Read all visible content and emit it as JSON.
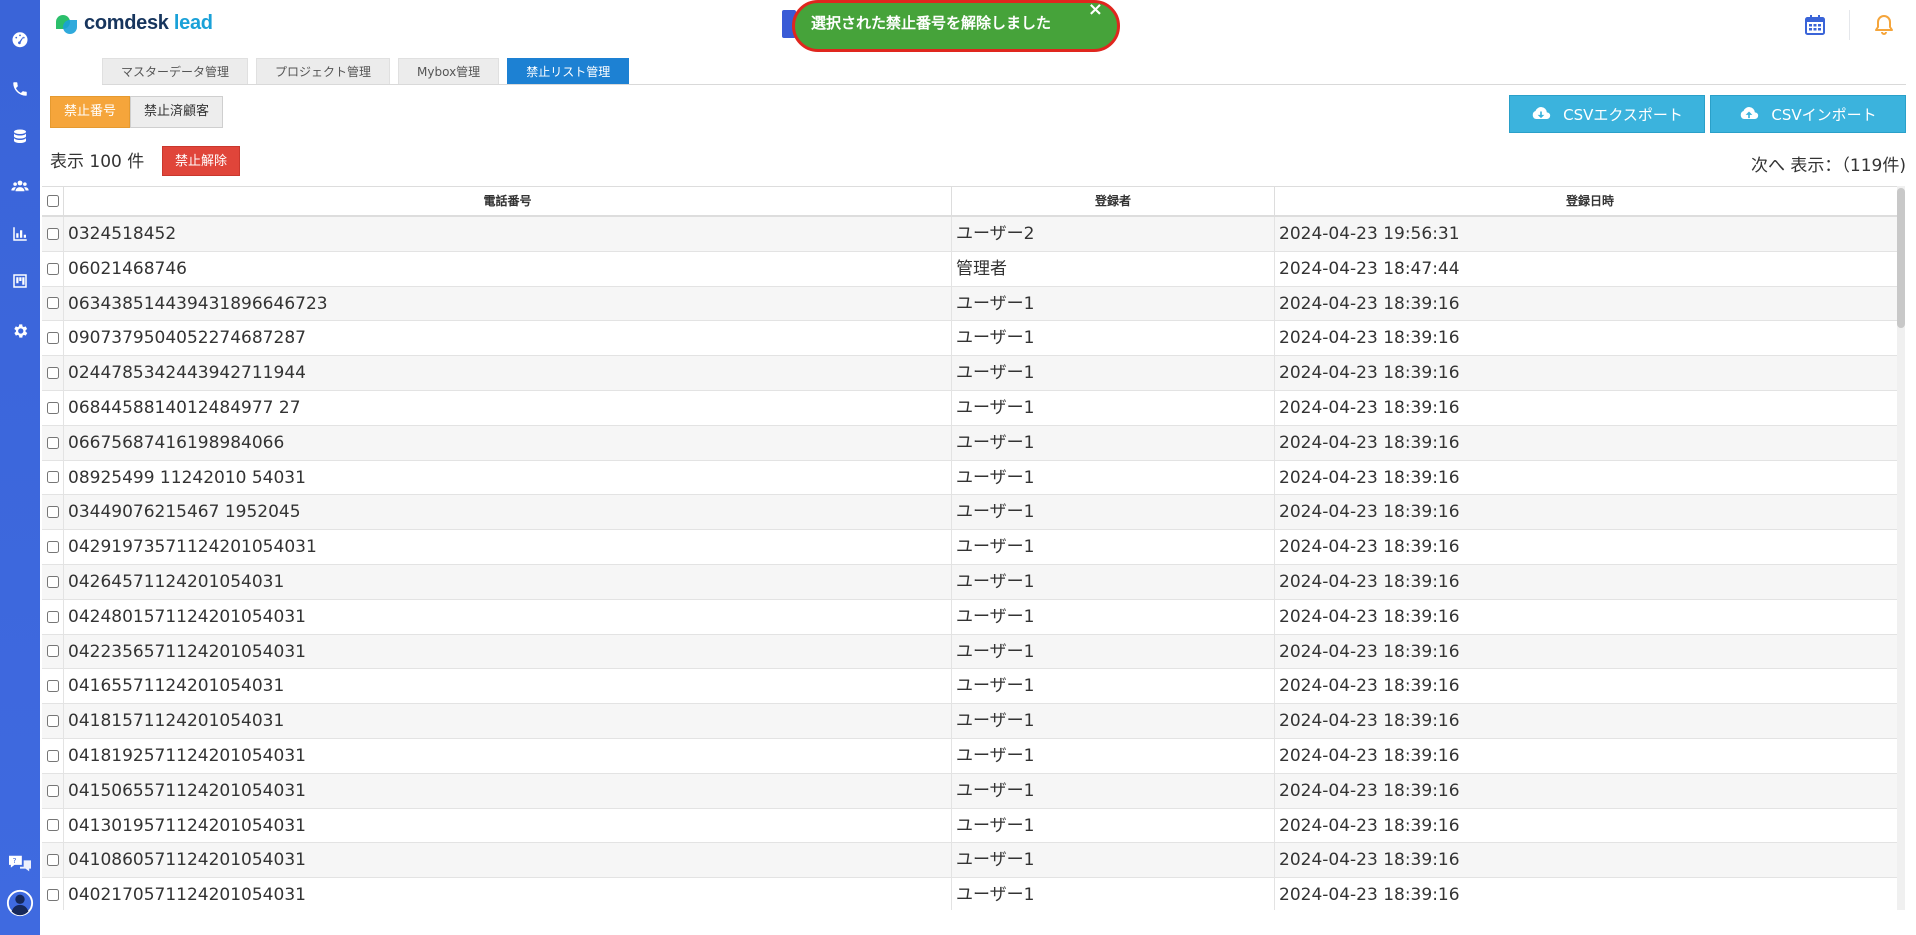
{
  "app": {
    "logo_main": "comdesk",
    "logo_sub": "lead"
  },
  "sidebar": {
    "icons": [
      "dashboard-icon",
      "phone-icon",
      "database-icon",
      "users-icon",
      "chart-icon",
      "kanban-icon",
      "settings-icon",
      "chat-help-icon",
      "profile-icon"
    ]
  },
  "toast": {
    "message": "選択された禁止番号を解除しました",
    "close": "×"
  },
  "header": {
    "icons": [
      "calendar-icon",
      "bell-icon"
    ],
    "colors": {
      "calendar": "#3a64d8",
      "bell": "#f5a53b"
    }
  },
  "tabs": [
    {
      "label": "マスターデータ管理",
      "active": false
    },
    {
      "label": "プロジェクト管理",
      "active": false
    },
    {
      "label": "Mybox管理",
      "active": false
    },
    {
      "label": "禁止リスト管理",
      "active": true
    }
  ],
  "toggle": {
    "numbers_label": "禁止番号",
    "customers_label": "禁止済顧客"
  },
  "csv": {
    "export_label": "CSVエクスポート",
    "import_label": "CSVインポート"
  },
  "list": {
    "show_count": "表示 100 件",
    "unblock_label": "禁止解除",
    "next_info": "次へ 表示：（119件)"
  },
  "table": {
    "headers": {
      "phone": "電話番号",
      "registrant": "登録者",
      "datetime": "登録日時"
    },
    "rows": [
      {
        "phone": "0324518452",
        "registrant": "ユーザー2",
        "datetime": "2024-04-23 19:56:31"
      },
      {
        "phone": "06021468746",
        "registrant": "管理者",
        "datetime": "2024-04-23 18:47:44"
      },
      {
        "phone": "063438514439431896646723",
        "registrant": "ユーザー1",
        "datetime": "2024-04-23 18:39:16"
      },
      {
        "phone": "0907379504052274687287",
        "registrant": "ユーザー1",
        "datetime": "2024-04-23 18:39:16"
      },
      {
        "phone": "0244785342443942711944",
        "registrant": "ユーザー1",
        "datetime": "2024-04-23 18:39:16"
      },
      {
        "phone": "0684458814012484977 27",
        "registrant": "ユーザー1",
        "datetime": "2024-04-23 18:39:16"
      },
      {
        "phone": "06675687416198984066",
        "registrant": "ユーザー1",
        "datetime": "2024-04-23 18:39:16"
      },
      {
        "phone": "08925499 11242010 54031",
        "registrant": "ユーザー1",
        "datetime": "2024-04-23 18:39:16"
      },
      {
        "phone": "03449076215467 1952045",
        "registrant": "ユーザー1",
        "datetime": "2024-04-23 18:39:16"
      },
      {
        "phone": "04291973571124201054031",
        "registrant": "ユーザー1",
        "datetime": "2024-04-23 18:39:16"
      },
      {
        "phone": "04264571124201054031",
        "registrant": "ユーザー1",
        "datetime": "2024-04-23 18:39:16"
      },
      {
        "phone": "0424801571124201054031",
        "registrant": "ユーザー1",
        "datetime": "2024-04-23 18:39:16"
      },
      {
        "phone": "0422356571124201054031",
        "registrant": "ユーザー1",
        "datetime": "2024-04-23 18:39:16"
      },
      {
        "phone": "04165571124201054031",
        "registrant": "ユーザー1",
        "datetime": "2024-04-23 18:39:16"
      },
      {
        "phone": "04181571124201054031",
        "registrant": "ユーザー1",
        "datetime": "2024-04-23 18:39:16"
      },
      {
        "phone": "0418192571124201054031",
        "registrant": "ユーザー1",
        "datetime": "2024-04-23 18:39:16"
      },
      {
        "phone": "0415065571124201054031",
        "registrant": "ユーザー1",
        "datetime": "2024-04-23 18:39:16"
      },
      {
        "phone": "0413019571124201054031",
        "registrant": "ユーザー1",
        "datetime": "2024-04-23 18:39:16"
      },
      {
        "phone": "0410860571124201054031",
        "registrant": "ユーザー1",
        "datetime": "2024-04-23 18:39:16"
      },
      {
        "phone": "0402170571124201054031",
        "registrant": "ユーザー1",
        "datetime": "2024-04-23 18:39:16"
      }
    ]
  }
}
